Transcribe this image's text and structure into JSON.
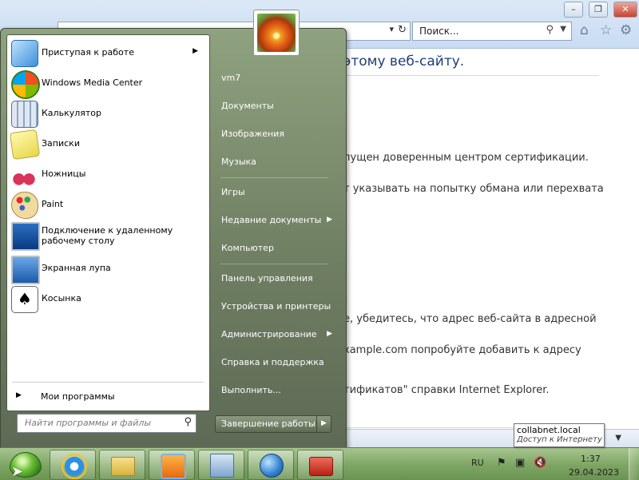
{
  "browser": {
    "search_placeholder": "Поиск...",
    "heading": "этому веб-сайту.",
    "lines": [
      "пущен доверенным центром сертификации.",
      "т указывать на попытку обмана или перехвата",
      "е, убедитесь, что адрес веб-сайта в адресной",
      "xample.com попробуйте добавить к адресу",
      "тификатов\" справки Internet Explorer."
    ]
  },
  "tooltip": {
    "host": "collabnet.local",
    "status": "Доступ к Интернету"
  },
  "start_menu": {
    "programs": [
      {
        "label": "Приступая к работе",
        "icon": "getting-started-icon",
        "submenu": true
      },
      {
        "label": "Windows Media Center",
        "icon": "media-center-icon",
        "submenu": false
      },
      {
        "label": "Калькулятор",
        "icon": "calculator-icon",
        "submenu": false
      },
      {
        "label": "Записки",
        "icon": "sticky-notes-icon",
        "submenu": false
      },
      {
        "label": "Ножницы",
        "icon": "snipping-tool-icon",
        "submenu": false
      },
      {
        "label": "Paint",
        "icon": "paint-icon",
        "submenu": false
      },
      {
        "label": "Подключение к удаленному",
        "label2": "рабочему столу",
        "icon": "remote-desktop-icon",
        "submenu": false
      },
      {
        "label": "Экранная лупа",
        "icon": "magnifier-icon",
        "submenu": false
      },
      {
        "label": "Косынка",
        "icon": "solitaire-icon",
        "submenu": false
      }
    ],
    "all_programs": "Мои программы",
    "search_placeholder": "Найти программы и файлы",
    "right_links": [
      {
        "label": "vm7"
      },
      {
        "label": "Документы"
      },
      {
        "label": "Изображения"
      },
      {
        "label": "Музыка"
      },
      {
        "label": "Игры"
      },
      {
        "label": "Недавние документы",
        "submenu": true
      },
      {
        "label": "Компьютер"
      },
      {
        "label": "Панель управления"
      },
      {
        "label": "Устройства и принтеры"
      },
      {
        "label": "Администрирование",
        "submenu": true
      },
      {
        "label": "Справка и поддержка"
      },
      {
        "label": "Выполнить..."
      }
    ],
    "shutdown": "Завершение работы"
  },
  "taskbar": {
    "pinned": [
      "internet-explorer-icon",
      "explorer-folder-icon",
      "media-player-icon",
      "control-panel-icon",
      "network-globe-icon",
      "toolbox-icon"
    ],
    "language": "RU",
    "time": "1:37",
    "date": "29.04.2023"
  },
  "colors": {
    "start_menu_green": "#6f7f62",
    "taskbar_green": "#7da562",
    "heading_blue": "#1f3d7a"
  }
}
